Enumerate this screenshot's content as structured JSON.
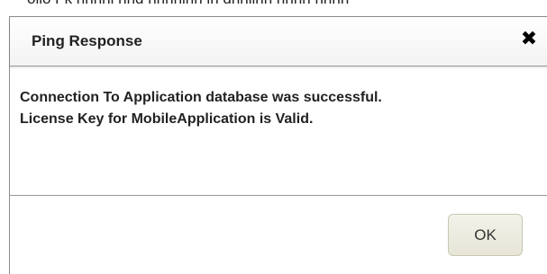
{
  "background": {
    "partial_text": "ollo Fk nnhnl nnd nnnnlnn ln dnnllnn nnnn nnnn"
  },
  "dialog": {
    "title": "Ping Response",
    "close_icon": "close-icon",
    "messages": [
      "Connection To Application database was successful.",
      "License Key for MobileApplication is Valid."
    ],
    "ok_label": "OK"
  },
  "colors": {
    "ok_button_bg": "#ebead9",
    "border": "#9a9a9a"
  }
}
